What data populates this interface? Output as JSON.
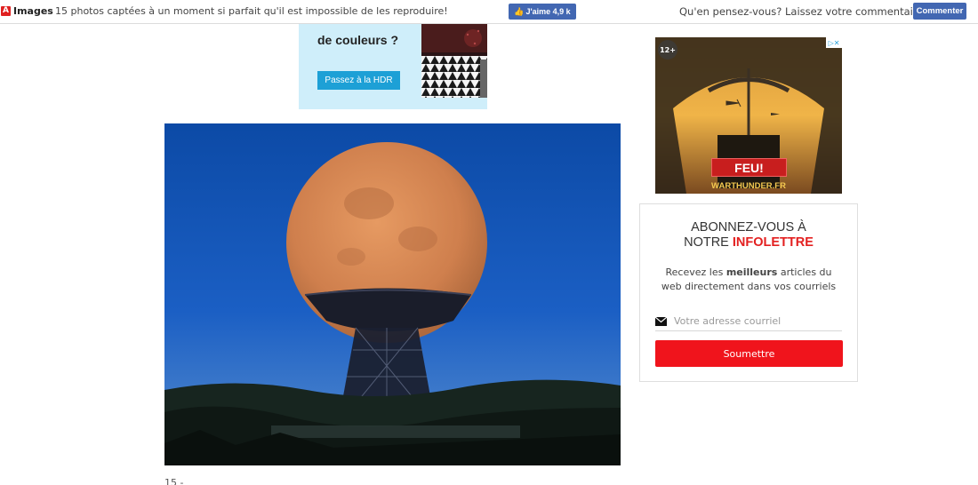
{
  "topbar": {
    "category": "Images",
    "separator": ":",
    "headline": "15 photos captées à un moment si parfait qu'il est impossible de les reproduire!",
    "like_label": "J'aime 4,9 k",
    "comment_prompt": "Qu'en pensez-vous? Laissez votre commentaire ici.",
    "comment_button": "Commenter",
    "brand_letter": "A"
  },
  "banner_ad": {
    "title": "de couleurs ?",
    "cta": "Passez à la HDR"
  },
  "main_photo": {
    "caption": "15 -"
  },
  "side_ad": {
    "age_rating": "12+",
    "adchoices": "▷✕",
    "button": "FEU!",
    "domain": "WARTHUNDER.FR"
  },
  "newsletter": {
    "title_line1": "ABONNEZ-VOUS À",
    "title_line2_prefix": "NOTRE ",
    "title_line2_accent": "INFOLETTRE",
    "desc_before": "Recevez les ",
    "desc_bold": "meilleurs",
    "desc_after": " articles du web directement dans vos courriels",
    "email_placeholder": "Votre adresse courriel",
    "submit": "Soumettre"
  },
  "colors": {
    "facebook_blue": "#4267b2",
    "accent_red": "#e32020",
    "submit_red": "#f0141c",
    "ad_background": "#cfeefa"
  }
}
